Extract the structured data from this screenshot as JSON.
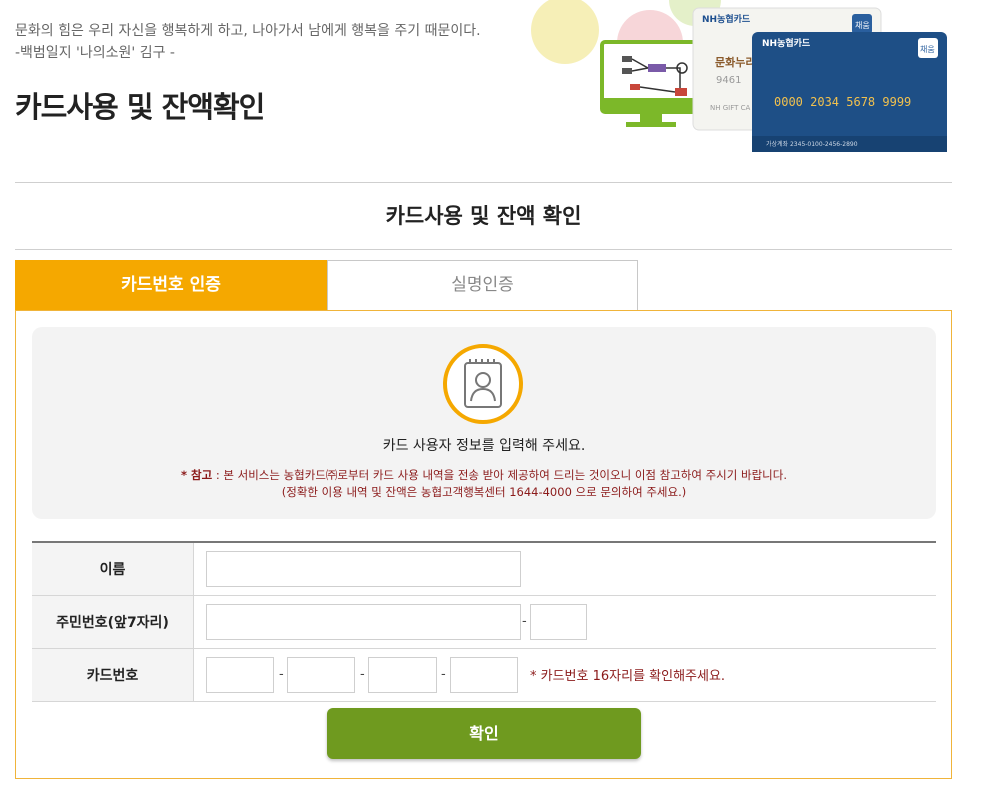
{
  "header": {
    "quote_line1": "문화의 힘은 우리 자신을 행복하게 하고, 나아가서 남에게 행복을 주기 때문이다.",
    "quote_line2": "-백범일지 '나의소원' 김구 -",
    "title": "카드사용 및 잔액확인"
  },
  "hero": {
    "card_front_brand": "NH농협카드",
    "card_front_badge": "채움",
    "card_front_number": "0000 2034 5678 9999",
    "card_front_footer": "가상계좌 2345-0100-2456-2890",
    "card_back_brand": "NH농협카드",
    "card_back_badge": "채움",
    "card_back_logo": "문화누리",
    "card_back_num": "9461",
    "card_back_label": "NH GIFT CA"
  },
  "section_title": "카드사용 및 잔액 확인",
  "tabs": [
    {
      "label": "카드번호 인증",
      "active": true
    },
    {
      "label": "실명인증",
      "active": false
    }
  ],
  "info": {
    "icon": "user-id-card-icon",
    "main_text": "카드 사용자 정보를 입력해 주세요.",
    "note_prefix": "* 참고",
    "note_line1": " : 본 서비스는 농협카드㈜로부터 카드 사용 내역을 전송 받아 제공하여 드리는 것이오니 이점 참고하여 주시기 바랍니다.",
    "note_line2": "(정확한 이용 내역 및 잔액은 농협고객행복센터 1644-4000 으로 문의하여 주세요.)"
  },
  "form": {
    "name_label": "이름",
    "rrn_label": "주민번호(앞7자리)",
    "card_label": "카드번호",
    "card_hint": "* 카드번호 16자리를 확인해주세요.",
    "dash": "-"
  },
  "confirm_label": "확인",
  "colors": {
    "accent_orange": "#f5a800",
    "button_green": "#6f9a1f",
    "note_red": "#8b1a1a"
  }
}
